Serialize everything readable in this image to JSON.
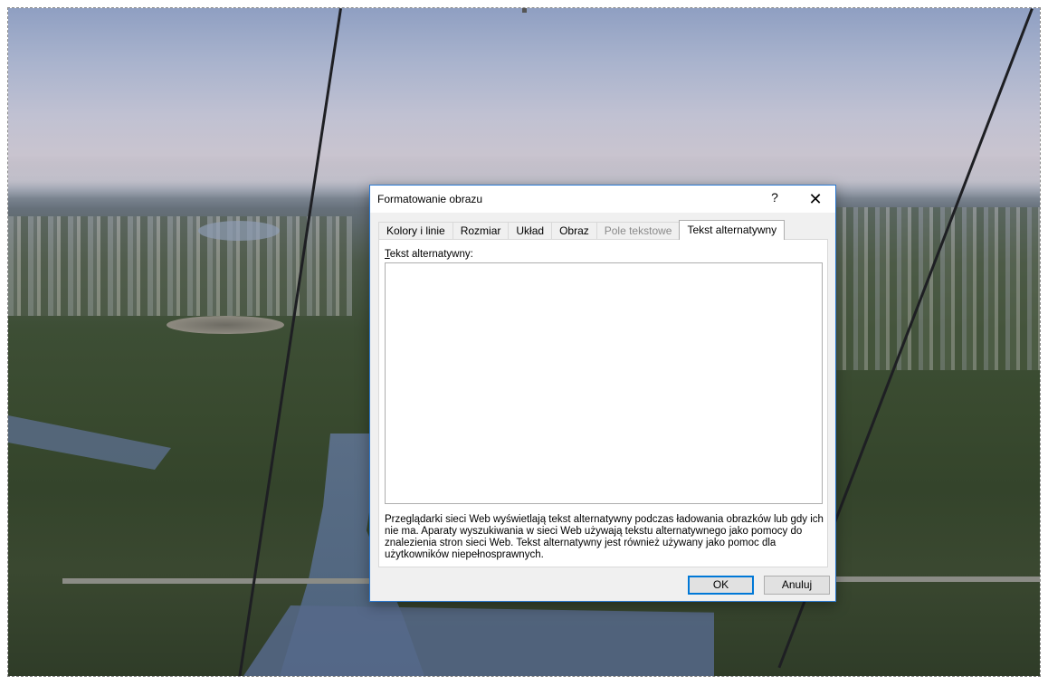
{
  "dialog": {
    "title": "Formatowanie obrazu",
    "help_label": "?",
    "close_label": "✕",
    "tabs": [
      {
        "label": "Kolory i linie",
        "state": "normal"
      },
      {
        "label": "Rozmiar",
        "state": "normal"
      },
      {
        "label": "Układ",
        "state": "normal"
      },
      {
        "label": "Obraz",
        "state": "normal"
      },
      {
        "label": "Pole tekstowe",
        "state": "disabled"
      },
      {
        "label": "Tekst alternatywny",
        "state": "active"
      }
    ],
    "alt_text": {
      "label_first": "T",
      "label_rest": "ekst alternatywny:",
      "value": ""
    },
    "help_text": "Przeglądarki sieci Web wyświetlają tekst alternatywny podczas ładowania obrazków lub gdy ich nie ma. Aparaty wyszukiwania w sieci Web używają tekstu alternatywnego jako pomocy do znalezienia stron sieci Web. Tekst alternatywny jest również używany jako pomoc dla użytkowników niepełnosprawnych.",
    "buttons": {
      "ok": "OK",
      "cancel": "Anuluj"
    }
  },
  "colors": {
    "dialog_border": "#2b79d1",
    "ok_focus": "#0078d7"
  },
  "icons": {
    "help": "question-mark-icon",
    "close": "close-icon"
  }
}
